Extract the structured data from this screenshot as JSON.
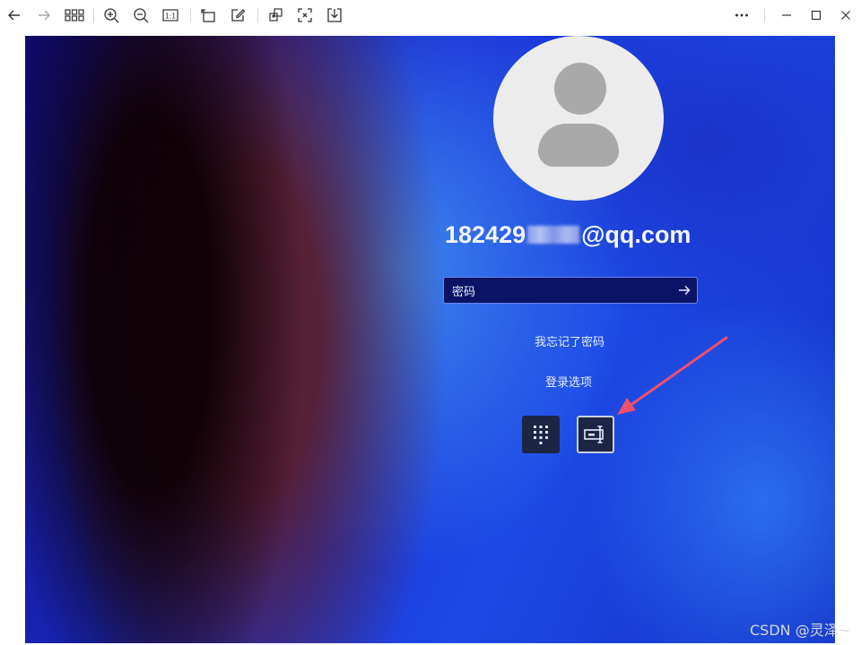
{
  "toolbar": {
    "left_icons": [
      "back-icon",
      "forward-icon",
      "grid-icon",
      "zoom-in-icon",
      "zoom-out-icon",
      "actual-size-icon",
      "rotate-icon",
      "edit-icon",
      "copy-icon",
      "screenshot-icon",
      "download-icon"
    ],
    "right_icons": [
      "more-icon",
      "minimize-icon",
      "maximize-icon",
      "close-icon"
    ],
    "actual_size_label": "1:1"
  },
  "login": {
    "email_prefix": "182429",
    "email_suffix": "@qq.com",
    "password_placeholder": "密码",
    "forgot_password": "我忘记了密码",
    "sign_in_options": "登录选项",
    "options": [
      {
        "icon": "pin-keypad-icon",
        "selected": false
      },
      {
        "icon": "password-key-icon",
        "selected": true
      }
    ]
  },
  "watermark": "CSDN @灵泽~",
  "colors": {
    "background_blue": "#1d49e6",
    "annotation_arrow": "#f0506e",
    "password_field": "#0a1365"
  }
}
